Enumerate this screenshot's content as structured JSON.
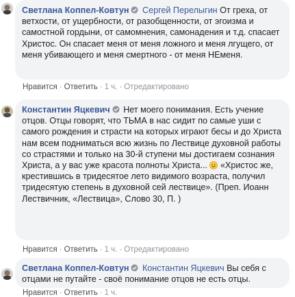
{
  "comments": [
    {
      "author": "Светлана Коппел-Ковтун",
      "mention": "Сергей Перелыгин",
      "text": "От греха, от ветхости, от ущербности, от разобщенности, от эгоизма и самостной гордыни, от самомнения, самонадения и т.д. спасает Христос. Он спасает меня от меня ложного и меня лгущего, от меня убивающего и меня смертного - от меня НЕменя.",
      "like": "Нравится",
      "reply": "Ответить",
      "time": "1 ч.",
      "edited": "Отредактировано"
    },
    {
      "author": "Константин Яцкевич",
      "text_before_emoji": "Нет моего понимания. Есть учение отцов. Отцы говорят, что ТЬМА в нас сидит по самые уши с самого рождения и страсти на которых играют бесы и до Христа нам всем подниматься всю жизнь по Лествице духовной работы со страстями и только на 30-й ступени мы достигаем сознания Христа, а у вас уже красота полноты Христа...",
      "text_after_emoji": "«Христос же, крестившись в тридесятое лето видимого возраста, получил тридесятую степень в духовной сей лествице». (Преп. Иоанн Лествичник, «Лествица», Слово 30, П. )",
      "emoji": "smile-emoji",
      "like": "Нравится",
      "reply": "Ответить",
      "time": "1 ч.",
      "edited": "Отредактировано"
    },
    {
      "author": "Светлана Коппел-Ковтун",
      "mention": "Константин Яцкевич",
      "text": "Вы себя с отцами не путайте - своё понимание отцов не есть отцы.",
      "like": "Нравится",
      "reply": "Ответить",
      "time": "1 ч."
    }
  ],
  "separator": "·",
  "colors": {
    "link": "#385898",
    "bubble": "#f2f3f5",
    "meta": "#90949c"
  }
}
